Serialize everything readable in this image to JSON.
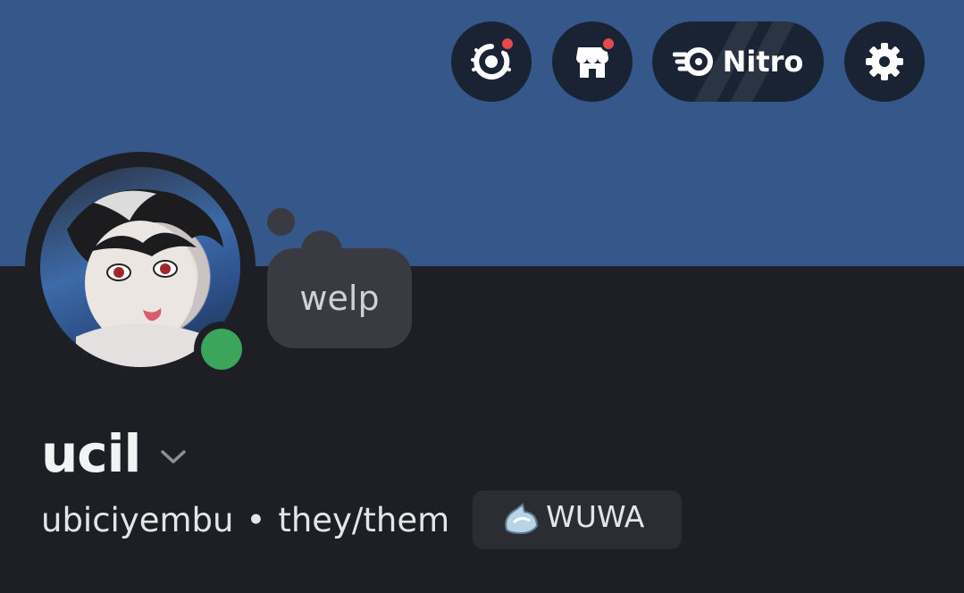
{
  "header": {
    "quests_icon": "quests-laurel-icon",
    "shop_icon": "shop-icon",
    "nitro": {
      "label": "Nitro",
      "icon": "nitro-icon"
    },
    "settings_icon": "gear-icon",
    "notification_color": "#e5484d"
  },
  "profile": {
    "display_name": "ucil",
    "username": "ubiciyembu",
    "separator": "•",
    "pronouns": "they/them",
    "status": "online",
    "status_color": "#3ba55c",
    "custom_status": "welp",
    "server_tag": {
      "label": "WUWA",
      "icon": "wuwa-badge-icon"
    }
  },
  "colors": {
    "banner": "#365789",
    "background": "#1e1f25"
  }
}
